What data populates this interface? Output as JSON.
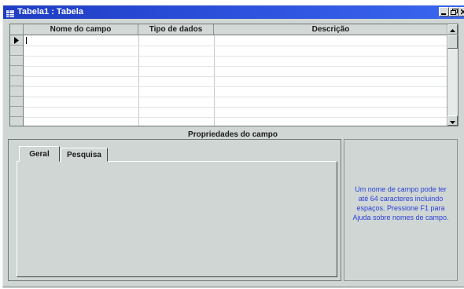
{
  "window": {
    "title": "Tabela1 : Tabela",
    "title_color": "#2f55e0",
    "icons": [
      "table-icon",
      "minimize-icon",
      "restore-icon",
      "close-icon"
    ]
  },
  "grid": {
    "columns": [
      "Nome do campo",
      "Tipo de dados",
      "Descrição"
    ],
    "row_count": 9,
    "current_row_indicator": "triangle-right"
  },
  "properties": {
    "title": "Propriedades do campo",
    "tabs": [
      "Geral",
      "Pesquisa"
    ],
    "active_tab": "Geral",
    "help_text": "Um nome de campo pode ter até 64 caracteres incluindo espaços. Pressione F1 para Ajuda sobre nomes de campo.",
    "help_color": "#2a3fd8"
  }
}
